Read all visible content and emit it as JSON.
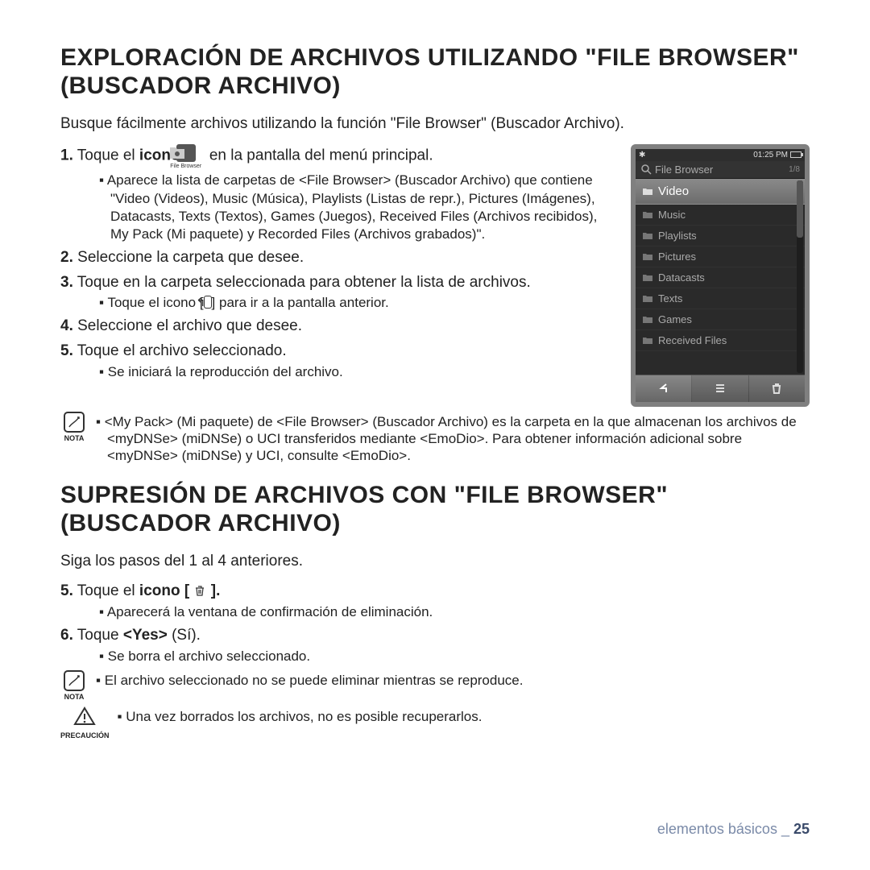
{
  "heading1": "EXPLORACIÓN DE ARCHIVOS UTILIZANDO \"FILE BROWSER\" (BUSCADOR ARCHIVO)",
  "intro1": "Busque fácilmente archivos utilizando la función \"File Browser\" (Buscador Archivo).",
  "step1_a": "1.",
  "step1_b": "Toque el ",
  "step1_c": "icono",
  "step1_d": " en la pantalla del menú principal.",
  "icon_caption": "File Browser",
  "sub1": "Aparece la lista de carpetas de <File Browser> (Buscador Archivo) que contiene \"Video (Videos), Music (Música), Playlists (Listas de repr.), Pictures (Imágenes), Datacasts, Texts (Textos), Games (Juegos), Received Files (Archivos recibidos), My Pack (Mi paquete) y Recorded Files (Archivos grabados)\".",
  "step2": "2. Seleccione la carpeta que desee.",
  "step3": "3. Toque en la carpeta seleccionada para obtener la lista de archivos.",
  "sub3_a": "Toque el icono [",
  "sub3_b": "] para ir a la pantalla anterior.",
  "step4": "4. Seleccione el archivo que desee.",
  "step5": "5. Toque el archivo seleccionado.",
  "sub5": "Se iniciará la reproducción del archivo.",
  "nota_label": "NOTA",
  "nota1": "<My Pack> (Mi paquete) de <File Browser> (Buscador Archivo) es la carpeta en la que almacenan los archivos de <myDNSe> (miDNSe) o UCI transferidos mediante <EmoDio>. Para obtener información adicional sobre <myDNSe> (miDNSe) y UCI, consulte <EmoDio>.",
  "heading2": "SUPRESIÓN DE ARCHIVOS CON \"FILE BROWSER\" (BUSCADOR ARCHIVO)",
  "intro2": "Siga los pasos del 1 al 4 anteriores.",
  "d_step5_a": "5.",
  "d_step5_b": " Toque el ",
  "d_step5_c": "icono [ ",
  "d_step5_d": " ].",
  "d_sub5": "Aparecerá la ventana de confirmación de eliminación.",
  "d_step6_a": "6.",
  "d_step6_b": " Toque ",
  "d_step6_c": "<Yes>",
  "d_step6_d": " (Sí).",
  "d_sub6": "Se borra el archivo seleccionado.",
  "nota2": "El archivo seleccionado no se puede eliminar mientras se reproduce.",
  "precaucion_label": "PRECAUCIÓN",
  "precaucion": "Una vez borrados los archivos, no es posible recuperarlos.",
  "footer_section": "elementos básicos _",
  "footer_page": "25",
  "device": {
    "time": "01:25 PM",
    "title": "File Browser",
    "count": "1/8",
    "items": [
      "Video",
      "Music",
      "Playlists",
      "Pictures",
      "Datacasts",
      "Texts",
      "Games",
      "Received Files"
    ]
  }
}
